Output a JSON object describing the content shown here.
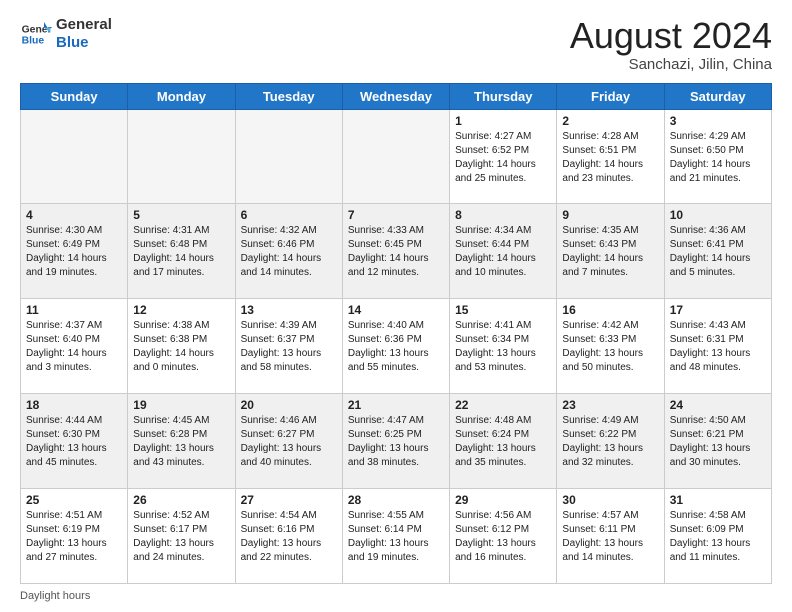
{
  "header": {
    "logo_general": "General",
    "logo_blue": "Blue",
    "month_year": "August 2024",
    "location": "Sanchazi, Jilin, China"
  },
  "days_of_week": [
    "Sunday",
    "Monday",
    "Tuesday",
    "Wednesday",
    "Thursday",
    "Friday",
    "Saturday"
  ],
  "weeks": [
    [
      {
        "num": "",
        "info": ""
      },
      {
        "num": "",
        "info": ""
      },
      {
        "num": "",
        "info": ""
      },
      {
        "num": "",
        "info": ""
      },
      {
        "num": "1",
        "info": "Sunrise: 4:27 AM\nSunset: 6:52 PM\nDaylight: 14 hours and 25 minutes."
      },
      {
        "num": "2",
        "info": "Sunrise: 4:28 AM\nSunset: 6:51 PM\nDaylight: 14 hours and 23 minutes."
      },
      {
        "num": "3",
        "info": "Sunrise: 4:29 AM\nSunset: 6:50 PM\nDaylight: 14 hours and 21 minutes."
      }
    ],
    [
      {
        "num": "4",
        "info": "Sunrise: 4:30 AM\nSunset: 6:49 PM\nDaylight: 14 hours and 19 minutes."
      },
      {
        "num": "5",
        "info": "Sunrise: 4:31 AM\nSunset: 6:48 PM\nDaylight: 14 hours and 17 minutes."
      },
      {
        "num": "6",
        "info": "Sunrise: 4:32 AM\nSunset: 6:46 PM\nDaylight: 14 hours and 14 minutes."
      },
      {
        "num": "7",
        "info": "Sunrise: 4:33 AM\nSunset: 6:45 PM\nDaylight: 14 hours and 12 minutes."
      },
      {
        "num": "8",
        "info": "Sunrise: 4:34 AM\nSunset: 6:44 PM\nDaylight: 14 hours and 10 minutes."
      },
      {
        "num": "9",
        "info": "Sunrise: 4:35 AM\nSunset: 6:43 PM\nDaylight: 14 hours and 7 minutes."
      },
      {
        "num": "10",
        "info": "Sunrise: 4:36 AM\nSunset: 6:41 PM\nDaylight: 14 hours and 5 minutes."
      }
    ],
    [
      {
        "num": "11",
        "info": "Sunrise: 4:37 AM\nSunset: 6:40 PM\nDaylight: 14 hours and 3 minutes."
      },
      {
        "num": "12",
        "info": "Sunrise: 4:38 AM\nSunset: 6:38 PM\nDaylight: 14 hours and 0 minutes."
      },
      {
        "num": "13",
        "info": "Sunrise: 4:39 AM\nSunset: 6:37 PM\nDaylight: 13 hours and 58 minutes."
      },
      {
        "num": "14",
        "info": "Sunrise: 4:40 AM\nSunset: 6:36 PM\nDaylight: 13 hours and 55 minutes."
      },
      {
        "num": "15",
        "info": "Sunrise: 4:41 AM\nSunset: 6:34 PM\nDaylight: 13 hours and 53 minutes."
      },
      {
        "num": "16",
        "info": "Sunrise: 4:42 AM\nSunset: 6:33 PM\nDaylight: 13 hours and 50 minutes."
      },
      {
        "num": "17",
        "info": "Sunrise: 4:43 AM\nSunset: 6:31 PM\nDaylight: 13 hours and 48 minutes."
      }
    ],
    [
      {
        "num": "18",
        "info": "Sunrise: 4:44 AM\nSunset: 6:30 PM\nDaylight: 13 hours and 45 minutes."
      },
      {
        "num": "19",
        "info": "Sunrise: 4:45 AM\nSunset: 6:28 PM\nDaylight: 13 hours and 43 minutes."
      },
      {
        "num": "20",
        "info": "Sunrise: 4:46 AM\nSunset: 6:27 PM\nDaylight: 13 hours and 40 minutes."
      },
      {
        "num": "21",
        "info": "Sunrise: 4:47 AM\nSunset: 6:25 PM\nDaylight: 13 hours and 38 minutes."
      },
      {
        "num": "22",
        "info": "Sunrise: 4:48 AM\nSunset: 6:24 PM\nDaylight: 13 hours and 35 minutes."
      },
      {
        "num": "23",
        "info": "Sunrise: 4:49 AM\nSunset: 6:22 PM\nDaylight: 13 hours and 32 minutes."
      },
      {
        "num": "24",
        "info": "Sunrise: 4:50 AM\nSunset: 6:21 PM\nDaylight: 13 hours and 30 minutes."
      }
    ],
    [
      {
        "num": "25",
        "info": "Sunrise: 4:51 AM\nSunset: 6:19 PM\nDaylight: 13 hours and 27 minutes."
      },
      {
        "num": "26",
        "info": "Sunrise: 4:52 AM\nSunset: 6:17 PM\nDaylight: 13 hours and 24 minutes."
      },
      {
        "num": "27",
        "info": "Sunrise: 4:54 AM\nSunset: 6:16 PM\nDaylight: 13 hours and 22 minutes."
      },
      {
        "num": "28",
        "info": "Sunrise: 4:55 AM\nSunset: 6:14 PM\nDaylight: 13 hours and 19 minutes."
      },
      {
        "num": "29",
        "info": "Sunrise: 4:56 AM\nSunset: 6:12 PM\nDaylight: 13 hours and 16 minutes."
      },
      {
        "num": "30",
        "info": "Sunrise: 4:57 AM\nSunset: 6:11 PM\nDaylight: 13 hours and 14 minutes."
      },
      {
        "num": "31",
        "info": "Sunrise: 4:58 AM\nSunset: 6:09 PM\nDaylight: 13 hours and 11 minutes."
      }
    ]
  ],
  "footer": {
    "daylight_hours": "Daylight hours"
  }
}
